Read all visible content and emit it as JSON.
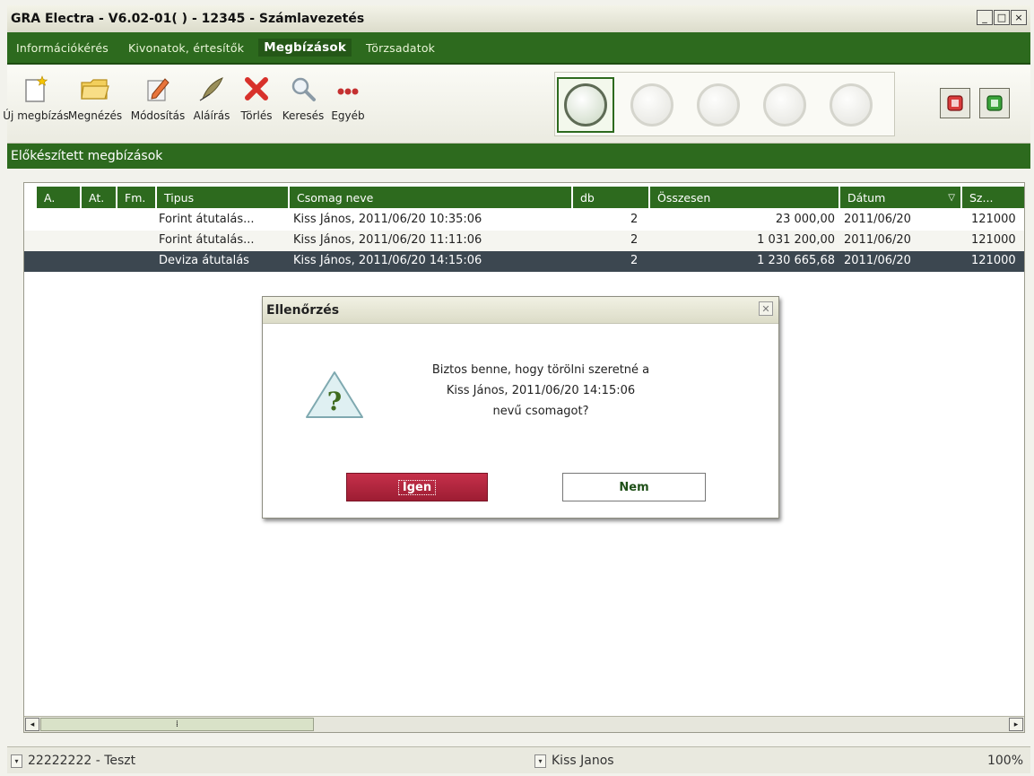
{
  "window": {
    "title": "GRA Electra - V6.02-01( ) - 12345 - Számlavezetés",
    "controls": [
      "_",
      "□",
      "×"
    ]
  },
  "menu": {
    "items": [
      "Információkérés",
      "Kivonatok, értesítők",
      "Megbízások",
      "Törzsadatok"
    ],
    "active": "Megbízások"
  },
  "toolbar": {
    "buttons": [
      {
        "label": "Új megbízás",
        "icon": "new-document-icon"
      },
      {
        "label": "Megnézés",
        "icon": "folder-icon"
      },
      {
        "label": "Módosítás",
        "icon": "edit-pencil-icon"
      },
      {
        "label": "Aláírás",
        "icon": "signature-quill-icon"
      },
      {
        "label": "Törlés",
        "icon": "delete-x-icon"
      },
      {
        "label": "Keresés",
        "icon": "magnifier-icon"
      },
      {
        "label": "Egyéb",
        "icon": "more-dots-icon"
      }
    ],
    "big_icons": [
      "transfer-money-icon",
      "cards-icon",
      "refresh-icon",
      "sign-icon",
      "stamp-icon"
    ],
    "book_buttons": [
      "phone-book-icon",
      "address-book-icon"
    ]
  },
  "section": {
    "title": "Előkészített megbízások"
  },
  "grid": {
    "headers": [
      "A.",
      "At.",
      "Fm.",
      "Tipus",
      "Csomag neve",
      "db",
      "Összesen",
      "Dátum",
      "Sz..."
    ],
    "rows": [
      {
        "tipus": "Forint átutalás...",
        "csomag": "Kiss János, 2011/06/20 10:35:06",
        "db": "2",
        "osszesen": "23 000,00",
        "datum": "2011/06/20",
        "sz": "121000"
      },
      {
        "tipus": "Forint átutalás...",
        "csomag": "Kiss János, 2011/06/20 11:11:06",
        "db": "2",
        "osszesen": "1 031 200,00",
        "datum": "2011/06/20",
        "sz": "121000"
      },
      {
        "tipus": "Deviza átutalás",
        "csomag": "Kiss János, 2011/06/20 14:15:06",
        "db": "2",
        "osszesen": "1 230 665,68",
        "datum": "2011/06/20",
        "sz": "121000"
      }
    ],
    "selected_row": 2
  },
  "dialog": {
    "title": "Ellenőrzés",
    "message_line1": "Biztos benne, hogy törölni szeretné a",
    "message_line2": "Kiss János, 2011/06/20 14:15:06",
    "message_line3": "nevű csomagot?",
    "yes_label": "Igen",
    "no_label": "Nem"
  },
  "status": {
    "account": "22222222 - Teszt",
    "user": "Kiss Janos",
    "zoom": "100%"
  },
  "colors": {
    "brand_green": "#2d6a1e",
    "selected_row": "#3c4750",
    "yes_button": "#b3263f"
  }
}
